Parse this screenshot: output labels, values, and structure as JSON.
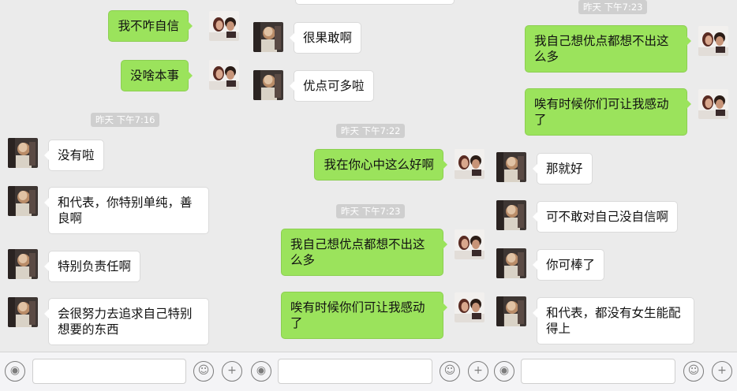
{
  "panel1": {
    "timestamp_1": "昨天 下午7:16",
    "messages": [
      "我不咋自信",
      "没啥本事",
      "没有啦",
      "和代表，你特别单纯，善良啊",
      "特别负责任啊",
      "会很努力去追求自己特别想要的东西"
    ]
  },
  "panel2": {
    "timestamp_1": "昨天 下午7:22",
    "timestamp_2": "昨天 下午7:23",
    "messages": [
      "很果敢啊",
      "优点可多啦",
      "我在你心中这么好啊",
      "我自己想优点都想不出这么多",
      "唉有时候你们可让我感动了"
    ]
  },
  "panel3": {
    "timestamp_1": "昨天 下午7:23",
    "messages": [
      "我自己想优点都想不出这么多",
      "唉有时候你们可让我感动了",
      "那就好",
      "可不敢对自己没自信啊",
      "你可棒了",
      "和代表，都没有女生能配得上"
    ]
  },
  "icons": [
    "voice-icon",
    "emoji-icon",
    "plus-icon",
    "avatar-self",
    "avatar-friend"
  ],
  "colors": {
    "outgoing_bubble": "#9be35c",
    "incoming_bubble": "#ffffff",
    "background": "#ebebeb"
  }
}
